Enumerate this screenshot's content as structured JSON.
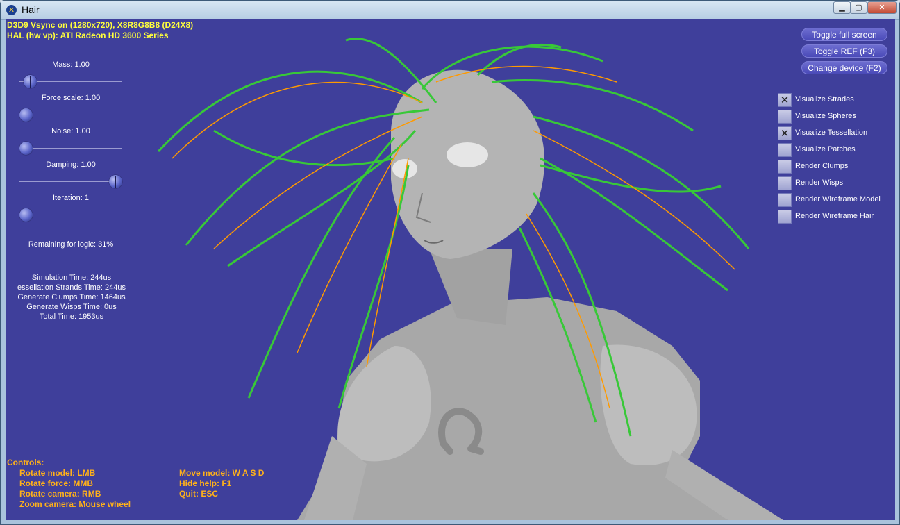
{
  "window": {
    "title": "Hair"
  },
  "hud": {
    "line1": "D3D9 Vsync on (1280x720), X8R8G8B8 (D24X8)",
    "line2": "HAL (hw vp): ATI Radeon HD 3600 Series"
  },
  "sliders": [
    {
      "label": "Mass: 1.00",
      "level": 0.05
    },
    {
      "label": "Force scale: 1.00",
      "level": 0.0
    },
    {
      "label": "Noise: 1.00",
      "level": 0.0
    },
    {
      "label": "Damping: 1.00",
      "level": 1.0
    },
    {
      "label": "Iteration: 1",
      "level": 0.0
    }
  ],
  "remaining": "Remaining for logic: 31%",
  "timings": [
    "Simulation Time: 244us",
    "essellation Strands Time: 244us",
    "Generate Clumps Time: 1464us",
    "Generate Wisps Time: 0us",
    "Total Time: 1953us"
  ],
  "buttons": {
    "fullscreen": "Toggle full screen",
    "ref": "Toggle REF (F3)",
    "device": "Change device (F2)"
  },
  "checkboxes": [
    {
      "label": "Visualize Strades",
      "checked": true
    },
    {
      "label": "Visualize Spheres",
      "checked": false
    },
    {
      "label": "Visualize Tessellation",
      "checked": true
    },
    {
      "label": "Visualize Patches",
      "checked": false
    },
    {
      "label": "Render Clumps",
      "checked": false
    },
    {
      "label": "Render Wisps",
      "checked": false
    },
    {
      "label": "Render Wireframe Model",
      "checked": false
    },
    {
      "label": "Render Wireframe Hair",
      "checked": false
    }
  ],
  "controls": {
    "heading": "Controls:",
    "left": [
      "Rotate model: LMB",
      "Rotate force: MMB",
      "Rotate camera: RMB",
      "Zoom camera: Mouse wheel"
    ],
    "right": [
      "Move model: W A S D",
      "Hide help: F1",
      "Quit: ESC"
    ]
  },
  "colors": {
    "background": "#3f3f9b",
    "hud_text": "#ffff3c",
    "controls_text": "#ffb11a",
    "hair_green": "#38c838",
    "hair_orange": "#ff9a00"
  }
}
